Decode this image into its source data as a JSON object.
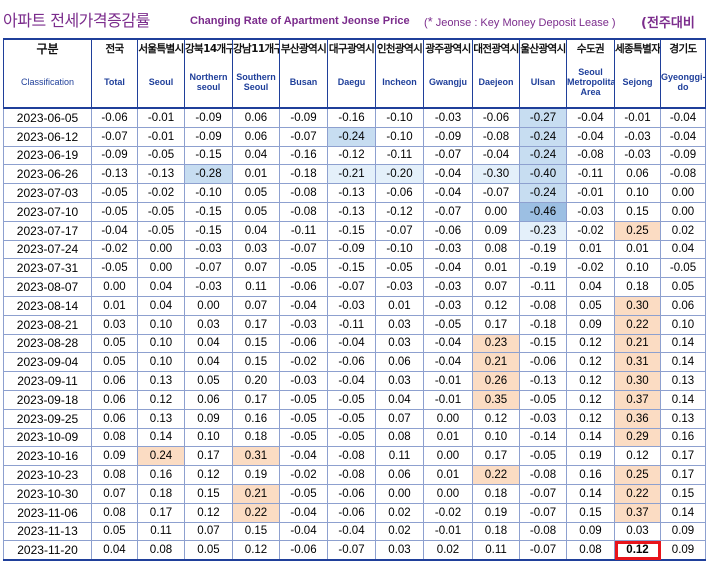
{
  "title": {
    "korean": "아파트 전세가격증감률",
    "english": "Changing Rate of Apartment Jeonse Price",
    "note_mark": "*",
    "note": "Jeonse : Key Money Deposit Lease )",
    "note_open": "(",
    "badge": "(전주대비"
  },
  "header": {
    "class_ko": "구분",
    "class_en": "Classification",
    "columns": [
      {
        "ko": "전국",
        "en": "Total"
      },
      {
        "ko": "서울특별시",
        "en": "Seoul"
      },
      {
        "ko": "강북14개구",
        "en": "Northern seoul"
      },
      {
        "ko": "강남11개구",
        "en": "Southern Seoul"
      },
      {
        "ko": "부산광역시",
        "en": "Busan"
      },
      {
        "ko": "대구광역시",
        "en": "Daegu"
      },
      {
        "ko": "인천광역시",
        "en": "Incheon"
      },
      {
        "ko": "광주광역시",
        "en": "Gwangju"
      },
      {
        "ko": "대전광역시",
        "en": "Daejeon"
      },
      {
        "ko": "울산광역시",
        "en": "Ulsan"
      },
      {
        "ko": "수도권",
        "en": "Seoul Metropolitan Area"
      },
      {
        "ko": "세종특별자치시",
        "en": "Sejong"
      },
      {
        "ko": "경기도",
        "en": "Gyeonggi-do"
      }
    ]
  },
  "rows": [
    {
      "date": "2023-06-05",
      "values": [
        "-0.06",
        "-0.01",
        "-0.09",
        "0.06",
        "-0.09",
        "-0.16",
        "-0.10",
        "-0.03",
        "-0.06",
        "-0.27",
        "-0.04",
        "-0.01",
        "-0.04"
      ],
      "shade": [
        "",
        "",
        "",
        "",
        "",
        "",
        "",
        "",
        "",
        "bm",
        "",
        "",
        ""
      ]
    },
    {
      "date": "2023-06-12",
      "values": [
        "-0.07",
        "-0.01",
        "-0.09",
        "0.06",
        "-0.07",
        "-0.24",
        "-0.10",
        "-0.09",
        "-0.08",
        "-0.24",
        "-0.04",
        "-0.03",
        "-0.04"
      ],
      "shade": [
        "",
        "",
        "",
        "",
        "",
        "bm",
        "",
        "",
        "",
        "bm",
        "",
        "",
        ""
      ]
    },
    {
      "date": "2023-06-19",
      "values": [
        "-0.09",
        "-0.05",
        "-0.15",
        "0.04",
        "-0.16",
        "-0.12",
        "-0.11",
        "-0.07",
        "-0.04",
        "-0.24",
        "-0.08",
        "-0.03",
        "-0.09"
      ],
      "shade": [
        "",
        "",
        "",
        "",
        "",
        "",
        "",
        "",
        "",
        "bm",
        "",
        "",
        ""
      ]
    },
    {
      "date": "2023-06-26",
      "values": [
        "-0.13",
        "-0.13",
        "-0.28",
        "0.01",
        "-0.18",
        "-0.21",
        "-0.20",
        "-0.04",
        "-0.30",
        "-0.40",
        "-0.11",
        "0.06",
        "-0.08"
      ],
      "shade": [
        "",
        "",
        "bm",
        "",
        "",
        "bl",
        "bl",
        "",
        "bl",
        "bm",
        "",
        "",
        ""
      ]
    },
    {
      "date": "2023-07-03",
      "values": [
        "-0.05",
        "-0.02",
        "-0.10",
        "0.05",
        "-0.08",
        "-0.13",
        "-0.06",
        "-0.04",
        "-0.07",
        "-0.24",
        "-0.01",
        "0.10",
        "0.00"
      ],
      "shade": [
        "",
        "",
        "",
        "",
        "",
        "",
        "",
        "",
        "",
        "bm",
        "",
        "",
        ""
      ]
    },
    {
      "date": "2023-07-10",
      "values": [
        "-0.05",
        "-0.05",
        "-0.15",
        "0.05",
        "-0.08",
        "-0.13",
        "-0.12",
        "-0.07",
        "0.00",
        "-0.46",
        "-0.03",
        "0.15",
        "0.00"
      ],
      "shade": [
        "",
        "",
        "",
        "",
        "",
        "",
        "",
        "",
        "",
        "bd",
        "",
        "",
        ""
      ]
    },
    {
      "date": "2023-07-17",
      "values": [
        "-0.04",
        "-0.05",
        "-0.15",
        "0.04",
        "-0.11",
        "-0.15",
        "-0.07",
        "-0.06",
        "0.09",
        "-0.23",
        "-0.02",
        "0.25",
        "0.02"
      ],
      "shade": [
        "",
        "",
        "",
        "",
        "",
        "",
        "",
        "",
        "",
        "bl",
        "",
        "or",
        ""
      ]
    },
    {
      "date": "2023-07-24",
      "values": [
        "-0.02",
        "0.00",
        "-0.03",
        "0.03",
        "-0.07",
        "-0.09",
        "-0.10",
        "-0.03",
        "0.08",
        "-0.19",
        "0.01",
        "0.01",
        "0.04"
      ],
      "shade": [
        "",
        "",
        "",
        "",
        "",
        "",
        "",
        "",
        "",
        "",
        "",
        "",
        ""
      ]
    },
    {
      "date": "2023-07-31",
      "values": [
        "-0.05",
        "0.00",
        "-0.07",
        "0.07",
        "-0.05",
        "-0.15",
        "-0.05",
        "-0.04",
        "0.01",
        "-0.19",
        "-0.02",
        "0.10",
        "-0.05"
      ],
      "shade": [
        "",
        "",
        "",
        "",
        "",
        "",
        "",
        "",
        "",
        "",
        "",
        "",
        ""
      ]
    },
    {
      "date": "2023-08-07",
      "values": [
        "0.00",
        "0.04",
        "-0.03",
        "0.11",
        "-0.06",
        "-0.07",
        "-0.03",
        "-0.03",
        "0.07",
        "-0.11",
        "0.04",
        "0.18",
        "0.05"
      ],
      "shade": [
        "",
        "",
        "",
        "",
        "",
        "",
        "",
        "",
        "",
        "",
        "",
        "",
        ""
      ]
    },
    {
      "date": "2023-08-14",
      "values": [
        "0.01",
        "0.04",
        "0.00",
        "0.07",
        "-0.04",
        "-0.03",
        "0.01",
        "-0.03",
        "0.12",
        "-0.08",
        "0.05",
        "0.30",
        "0.06"
      ],
      "shade": [
        "",
        "",
        "",
        "",
        "",
        "",
        "",
        "",
        "",
        "",
        "",
        "or",
        ""
      ]
    },
    {
      "date": "2023-08-21",
      "values": [
        "0.03",
        "0.10",
        "0.03",
        "0.17",
        "-0.03",
        "-0.11",
        "0.03",
        "-0.05",
        "0.17",
        "-0.18",
        "0.09",
        "0.22",
        "0.10"
      ],
      "shade": [
        "",
        "",
        "",
        "",
        "",
        "",
        "",
        "",
        "",
        "",
        "",
        "or",
        ""
      ]
    },
    {
      "date": "2023-08-28",
      "values": [
        "0.05",
        "0.10",
        "0.04",
        "0.15",
        "-0.06",
        "-0.04",
        "0.03",
        "-0.04",
        "0.23",
        "-0.15",
        "0.12",
        "0.21",
        "0.14"
      ],
      "shade": [
        "",
        "",
        "",
        "",
        "",
        "",
        "",
        "",
        "or",
        "",
        "",
        "or",
        ""
      ]
    },
    {
      "date": "2023-09-04",
      "values": [
        "0.05",
        "0.10",
        "0.04",
        "0.15",
        "-0.02",
        "-0.06",
        "0.06",
        "-0.04",
        "0.21",
        "-0.06",
        "0.12",
        "0.31",
        "0.14"
      ],
      "shade": [
        "",
        "",
        "",
        "",
        "",
        "",
        "",
        "",
        "or",
        "",
        "",
        "or",
        ""
      ]
    },
    {
      "date": "2023-09-11",
      "values": [
        "0.06",
        "0.13",
        "0.05",
        "0.20",
        "-0.03",
        "-0.04",
        "0.03",
        "-0.01",
        "0.26",
        "-0.13",
        "0.12",
        "0.30",
        "0.13"
      ],
      "shade": [
        "",
        "",
        "",
        "",
        "",
        "",
        "",
        "",
        "or",
        "",
        "",
        "or",
        ""
      ]
    },
    {
      "date": "2023-09-18",
      "values": [
        "0.06",
        "0.12",
        "0.06",
        "0.17",
        "-0.05",
        "-0.05",
        "0.04",
        "-0.01",
        "0.35",
        "-0.05",
        "0.12",
        "0.37",
        "0.14"
      ],
      "shade": [
        "",
        "",
        "",
        "",
        "",
        "",
        "",
        "",
        "or",
        "",
        "",
        "or",
        ""
      ]
    },
    {
      "date": "2023-09-25",
      "values": [
        "0.06",
        "0.13",
        "0.09",
        "0.16",
        "-0.05",
        "-0.05",
        "0.07",
        "0.00",
        "0.12",
        "-0.03",
        "0.12",
        "0.36",
        "0.13"
      ],
      "shade": [
        "",
        "",
        "",
        "",
        "",
        "",
        "",
        "",
        "",
        "",
        "",
        "or",
        ""
      ]
    },
    {
      "date": "2023-10-09",
      "values": [
        "0.08",
        "0.14",
        "0.10",
        "0.18",
        "-0.05",
        "-0.05",
        "0.08",
        "0.01",
        "0.10",
        "-0.14",
        "0.14",
        "0.29",
        "0.16"
      ],
      "shade": [
        "",
        "",
        "",
        "",
        "",
        "",
        "",
        "",
        "",
        "",
        "",
        "or",
        ""
      ]
    },
    {
      "date": "2023-10-16",
      "values": [
        "0.09",
        "0.24",
        "0.17",
        "0.31",
        "-0.04",
        "-0.08",
        "0.11",
        "0.00",
        "0.17",
        "-0.05",
        "0.19",
        "0.12",
        "0.17"
      ],
      "shade": [
        "",
        "or",
        "",
        "or",
        "",
        "",
        "",
        "",
        "",
        "",
        "",
        "",
        ""
      ]
    },
    {
      "date": "2023-10-23",
      "values": [
        "0.08",
        "0.16",
        "0.12",
        "0.19",
        "-0.02",
        "-0.08",
        "0.06",
        "0.01",
        "0.22",
        "-0.08",
        "0.16",
        "0.25",
        "0.17"
      ],
      "shade": [
        "",
        "",
        "",
        "",
        "",
        "",
        "",
        "",
        "or",
        "",
        "",
        "or",
        ""
      ]
    },
    {
      "date": "2023-10-30",
      "values": [
        "0.07",
        "0.18",
        "0.15",
        "0.21",
        "-0.05",
        "-0.06",
        "0.00",
        "0.00",
        "0.18",
        "-0.07",
        "0.14",
        "0.22",
        "0.15"
      ],
      "shade": [
        "",
        "",
        "",
        "or",
        "",
        "",
        "",
        "",
        "",
        "",
        "",
        "or",
        ""
      ]
    },
    {
      "date": "2023-11-06",
      "values": [
        "0.08",
        "0.17",
        "0.12",
        "0.22",
        "-0.04",
        "-0.06",
        "0.02",
        "-0.02",
        "0.19",
        "-0.07",
        "0.15",
        "0.37",
        "0.14"
      ],
      "shade": [
        "",
        "",
        "",
        "or",
        "",
        "",
        "",
        "",
        "",
        "",
        "",
        "or",
        ""
      ]
    },
    {
      "date": "2023-11-13",
      "values": [
        "0.05",
        "0.11",
        "0.07",
        "0.15",
        "-0.04",
        "-0.04",
        "0.02",
        "-0.01",
        "0.18",
        "-0.08",
        "0.09",
        "0.03",
        "0.09"
      ],
      "shade": [
        "",
        "",
        "",
        "",
        "",
        "",
        "",
        "",
        "",
        "",
        "",
        "",
        ""
      ]
    },
    {
      "date": "2023-11-20",
      "values": [
        "0.04",
        "0.08",
        "0.05",
        "0.12",
        "-0.06",
        "-0.07",
        "0.03",
        "0.02",
        "0.11",
        "-0.07",
        "0.08",
        "0.12",
        "0.09"
      ],
      "shade": [
        "",
        "",
        "",
        "",
        "",
        "",
        "",
        "",
        "",
        "",
        "",
        "hilite",
        ""
      ]
    }
  ],
  "colors": {
    "title": "#7b2c8c",
    "header_text": "#1f3f9a",
    "negative_shade": "#9cbfe3",
    "positive_shade": "#fbdcc3",
    "highlight_border": "#e8141b"
  }
}
